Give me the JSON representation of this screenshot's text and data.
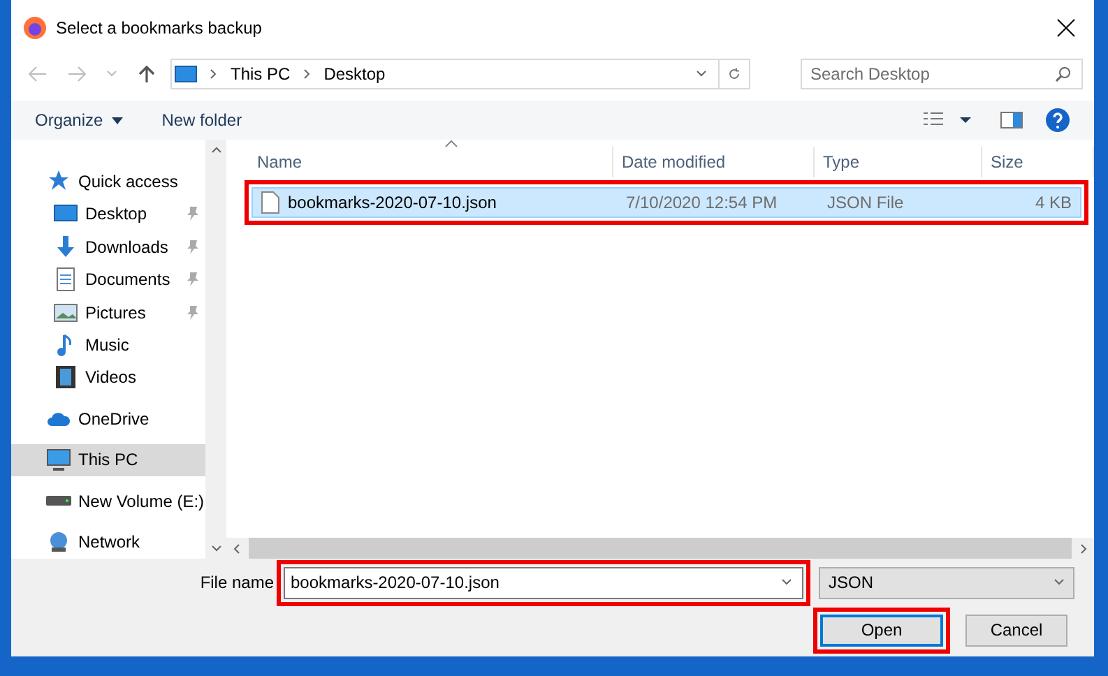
{
  "window": {
    "title": "Select a bookmarks backup"
  },
  "address_bar": {
    "path": [
      "This PC",
      "Desktop"
    ]
  },
  "search": {
    "placeholder": "Search Desktop"
  },
  "toolbar": {
    "organize": "Organize",
    "new_folder": "New folder"
  },
  "navigation": [
    {
      "label": "Quick access",
      "selected": false,
      "children": [
        {
          "label": "Desktop",
          "pinned": true,
          "selected": false
        },
        {
          "label": "Downloads",
          "pinned": true,
          "selected": false
        },
        {
          "label": "Documents",
          "pinned": true,
          "selected": false
        },
        {
          "label": "Pictures",
          "pinned": true,
          "selected": false
        },
        {
          "label": "Music",
          "pinned": false,
          "selected": false
        },
        {
          "label": "Videos",
          "pinned": false,
          "selected": false
        }
      ]
    },
    {
      "label": "OneDrive",
      "selected": false
    },
    {
      "label": "This PC",
      "selected": true
    },
    {
      "label": "New Volume (E:)",
      "selected": false
    },
    {
      "label": "Network",
      "selected": false
    }
  ],
  "file_list": {
    "columns": [
      "Name",
      "Date modified",
      "Type",
      "Size"
    ],
    "rows": [
      {
        "name": "bookmarks-2020-07-10.json",
        "date_modified": "7/10/2020 12:54 PM",
        "type": "JSON File",
        "size": "4 KB",
        "selected": true,
        "highlighted": true
      }
    ]
  },
  "file_name": {
    "label": "File name",
    "value": "bookmarks-2020-07-10.json",
    "highlighted": true
  },
  "file_type": {
    "value": "JSON"
  },
  "buttons": [
    {
      "label": "Open",
      "kind": "primary",
      "highlighted": true
    },
    {
      "label": "Cancel",
      "kind": "secondary",
      "highlighted": false
    }
  ]
}
